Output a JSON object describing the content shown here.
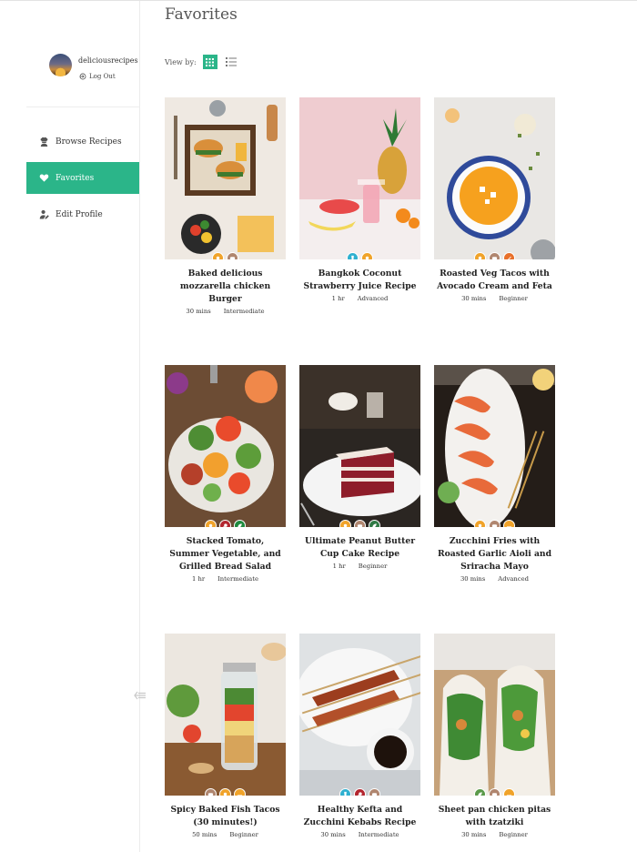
{
  "page": {
    "title": "Favorites"
  },
  "user": {
    "username": "deliciousrecipes",
    "logout_label": "Log Out"
  },
  "nav": {
    "browse": "Browse Recipes",
    "favorites": "Favorites",
    "edit_profile": "Edit Profile"
  },
  "view": {
    "label": "View by:",
    "mode_selected": "grid"
  },
  "colors": {
    "accent": "#2bb589",
    "badge_orange": "#f0a32a",
    "badge_brown": "#b0866f",
    "badge_red": "#b3262f",
    "badge_green": "#1e8a3e",
    "badge_blue": "#2fb0d0",
    "badge_darkgreen": "#2f7a45"
  },
  "recipes": [
    {
      "title": "Baked delicious mozzarella chicken Burger",
      "time": "30 mins",
      "level": "Intermediate",
      "badges": [
        "ingredient-icon",
        "bread-icon"
      ]
    },
    {
      "title": "Bangkok Coconut Strawberry Juice Recipe",
      "time": "1 hr",
      "level": "Advanced",
      "badges": [
        "drink-icon",
        "ingredient-icon"
      ]
    },
    {
      "title": "Roasted Veg Tacos with Avocado Cream and Feta",
      "time": "30 mins",
      "level": "Beginner",
      "badges": [
        "ingredient-icon",
        "bread-icon",
        "spice-icon"
      ]
    },
    {
      "title": "Stacked Tomato, Summer Vegetable, and Grilled Bread Salad",
      "time": "1 hr",
      "level": "Intermediate",
      "badges": [
        "ingredient-icon",
        "meat-icon",
        "leaf-icon"
      ]
    },
    {
      "title": "Ultimate Peanut Butter Cup Cake Recipe",
      "time": "1 hr",
      "level": "Beginner",
      "badges": [
        "ingredient-icon",
        "bread-icon",
        "leaf-icon"
      ]
    },
    {
      "title": "Zucchini Fries with Roasted Garlic Aioli and Sriracha Mayo",
      "time": "30 mins",
      "level": "Advanced",
      "badges": [
        "ingredient-icon",
        "bread-icon",
        "dish-icon"
      ]
    },
    {
      "title": "Spicy Baked Fish Tacos (30 minutes!)",
      "time": "50 mins",
      "level": "Beginner",
      "badges": [
        "bread-icon",
        "ingredient-icon",
        "dish-icon"
      ]
    },
    {
      "title": "Healthy Kefta and Zucchini Kebabs Recipe",
      "time": "30 mins",
      "level": "Intermediate",
      "badges": [
        "drink-icon",
        "meat-icon",
        "bread-icon"
      ]
    },
    {
      "title": "Sheet pan chicken pitas with tzatziki",
      "time": "30 mins",
      "level": "Beginner",
      "badges": [
        "leaf-icon",
        "bread-icon",
        "dish-icon"
      ]
    }
  ]
}
